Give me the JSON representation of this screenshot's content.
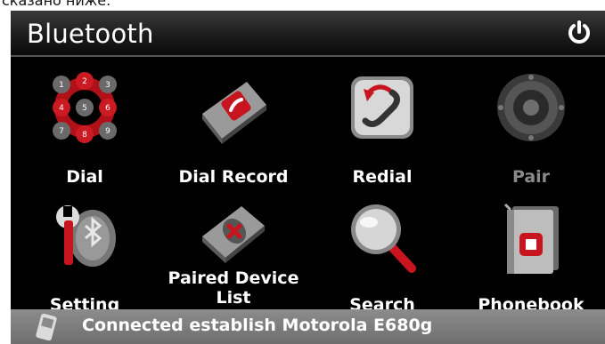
{
  "header_fragment": "сказано ниже:",
  "app": {
    "title": "Bluetooth"
  },
  "menu": {
    "items": [
      {
        "id": "dial",
        "label": "Dial",
        "icon": "dialpad-icon",
        "enabled": true
      },
      {
        "id": "dial-record",
        "label": "Dial Record",
        "icon": "call-log-icon",
        "enabled": true
      },
      {
        "id": "redial",
        "label": "Redial",
        "icon": "redial-phone-icon",
        "enabled": true
      },
      {
        "id": "pair",
        "label": "Pair",
        "icon": "speaker-icon",
        "enabled": false
      },
      {
        "id": "setting",
        "label": "Setting",
        "icon": "wrench-bluetooth-icon",
        "enabled": true
      },
      {
        "id": "paired-device-list",
        "label": "Paired Device List",
        "icon": "paired-device-icon",
        "enabled": true
      },
      {
        "id": "search",
        "label": "Search",
        "icon": "magnifier-icon",
        "enabled": true
      },
      {
        "id": "phonebook",
        "label": "Phonebook",
        "icon": "phonebook-icon",
        "enabled": true
      }
    ]
  },
  "status": {
    "text": "Connected establish Motorola E680g",
    "icon": "phone-device-icon"
  },
  "colors": {
    "background": "#000000",
    "title_bar": "#2a2a2a",
    "status_bar": "#7d7d7d",
    "accent_red": "#c8141e",
    "disabled_text": "#8a8a8a"
  }
}
